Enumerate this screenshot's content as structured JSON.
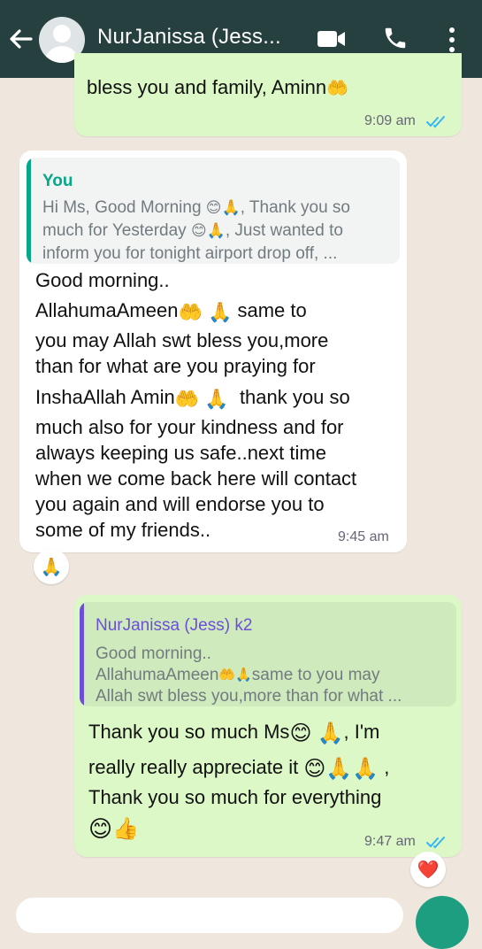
{
  "header": {
    "contact_name": "NurJanissa (Jess...",
    "colors": {
      "bar": "#25403f",
      "icons": "#ffffff"
    },
    "icons": [
      "back-arrow-icon",
      "avatar",
      "video-call-icon",
      "phone-icon",
      "more-options-icon"
    ]
  },
  "messages": [
    {
      "id": "m1",
      "direction": "outgoing",
      "text_lines": [
        "bless you and family, Aminn"
      ],
      "time": "9:09 am",
      "status": "read"
    },
    {
      "id": "m2",
      "direction": "incoming",
      "quote": {
        "author": "You",
        "lines": [
          "Hi Ms, Good Morning",
          ", Thank you so",
          "much for Yesterday",
          ", Just wanted to",
          "inform you for tonight airport drop off, ..."
        ]
      },
      "text_lines": [
        "Good morning..",
        "AllahumaAmeen",
        "same to",
        "you may Allah swt bless you,more",
        "than for what are you praying for",
        "InshaAllah Amin",
        "thank you so",
        "much also for your kindness and for",
        "always keeping us safe..next time",
        "when we come back here will contact",
        "you again and will endorse you to",
        "some of my friends.."
      ],
      "time": "9:45 am",
      "reaction": "🙏"
    },
    {
      "id": "m3",
      "direction": "outgoing",
      "quote": {
        "author": "NurJanissa (Jess) k2",
        "lines": [
          "Good morning..",
          "AllahumaAmeen",
          "same to you may",
          "Allah swt bless you,more than for what ..."
        ]
      },
      "text_lines": [
        "Thank you so much Ms",
        ", I'm",
        "really really appreciate it",
        ",",
        "Thank you so much for everything"
      ],
      "time": "9:47 am",
      "status": "read",
      "reaction": "❤️"
    }
  ],
  "colors": {
    "wallpaper": "#efe7dd",
    "outgoing_bubble": "#dcf8c6",
    "incoming_bubble": "#ffffff",
    "quote_you": "#06a88a",
    "quote_contact": "#6b4fd6",
    "read_ticks": "#34b7f1"
  }
}
